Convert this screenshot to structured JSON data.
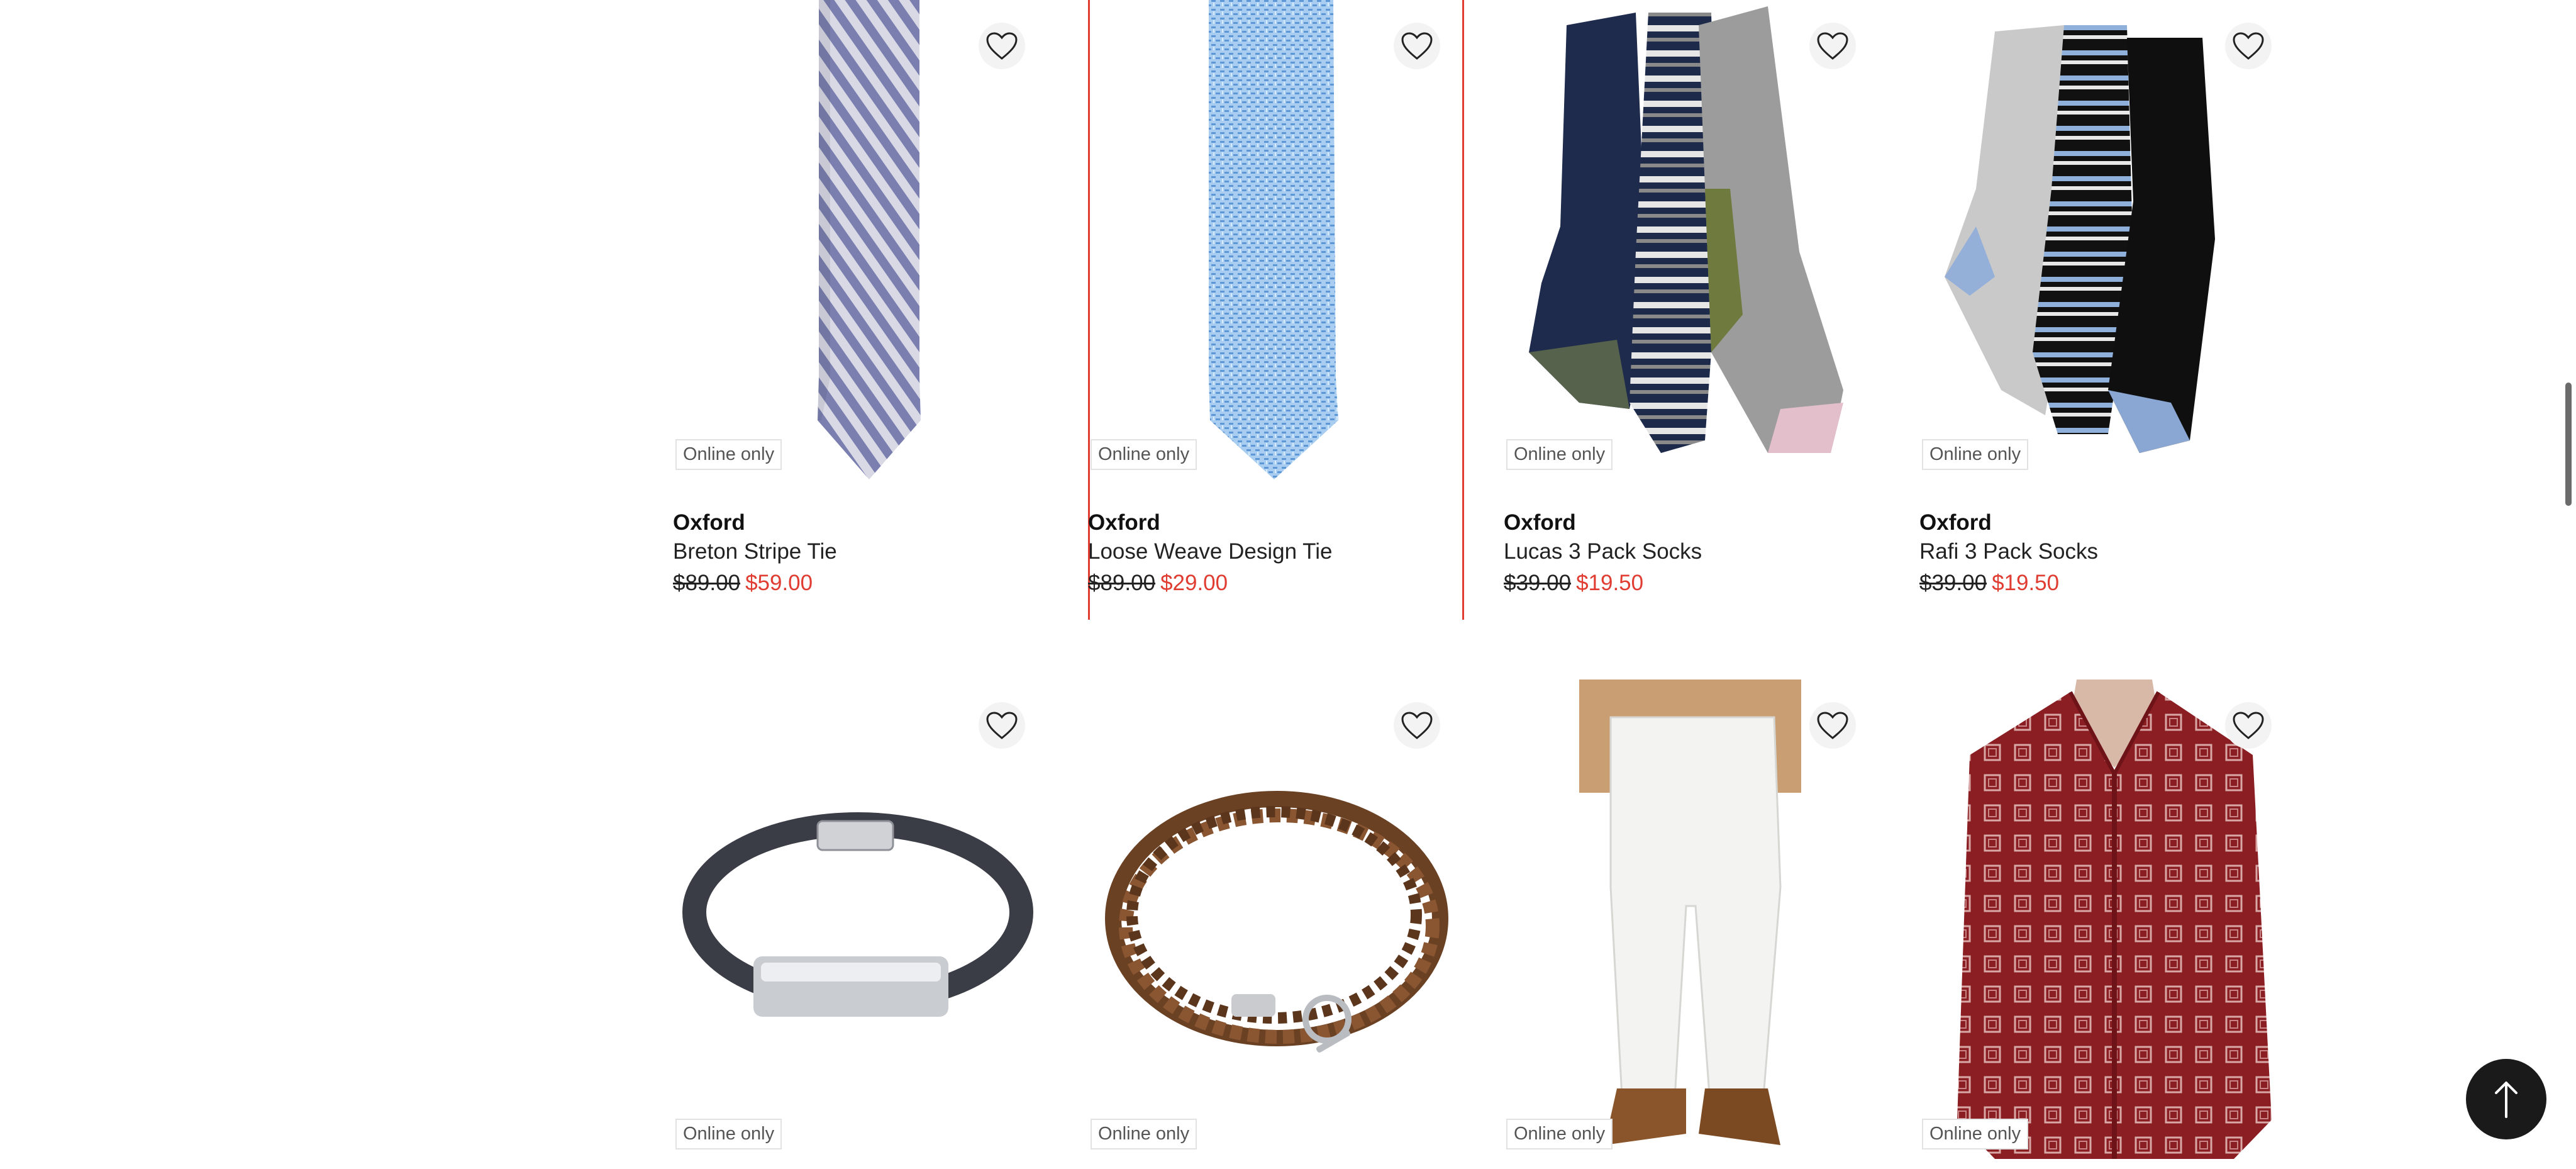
{
  "products": [
    {
      "badge": "Online only",
      "brand": "Oxford",
      "name": "Breton Stripe Tie",
      "was_price": "$89.00",
      "now_price": "$59.00"
    },
    {
      "badge": "Online only",
      "brand": "Oxford",
      "name": "Loose Weave Design Tie",
      "was_price": "$89.00",
      "now_price": "$29.00"
    },
    {
      "badge": "Online only",
      "brand": "Oxford",
      "name": "Lucas 3 Pack Socks",
      "was_price": "$39.00",
      "now_price": "$19.50"
    },
    {
      "badge": "Online only",
      "brand": "Oxford",
      "name": "Rafi 3 Pack Socks",
      "was_price": "$39.00",
      "now_price": "$19.50"
    },
    {
      "badge": "Online only"
    },
    {
      "badge": "Online only"
    },
    {
      "badge": "Online only"
    },
    {
      "badge": "Online only"
    }
  ],
  "colors": {
    "sale": "#e03c31",
    "selected_outline": "#e03c31",
    "back_to_top_bg": "#1a1a1a"
  },
  "icons": {
    "favorite": "heart-outline-icon",
    "back_to_top": "arrow-up-icon"
  }
}
